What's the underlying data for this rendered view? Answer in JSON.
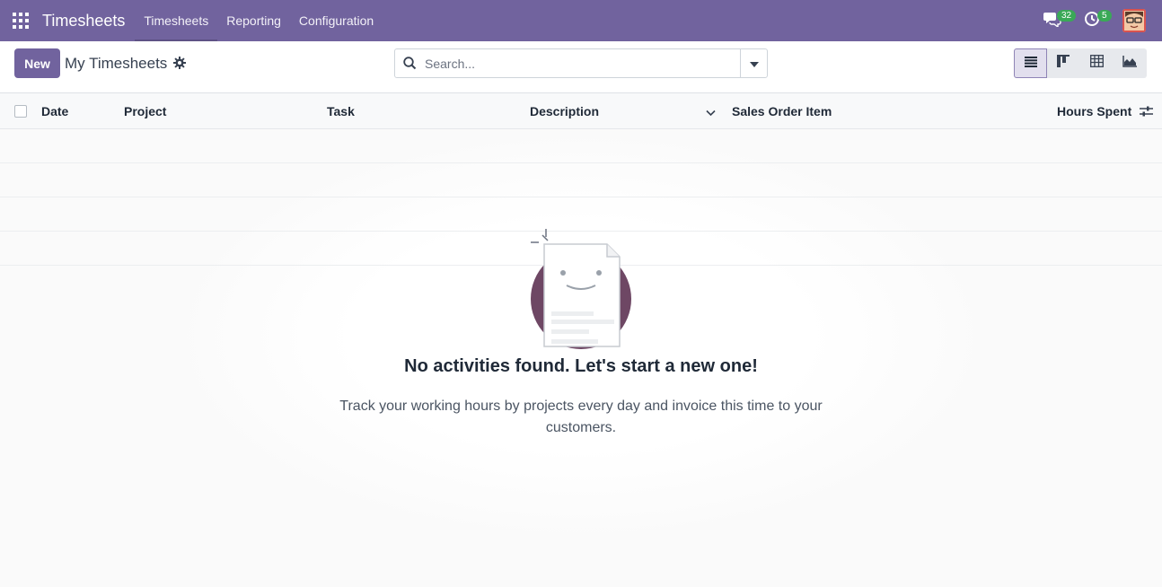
{
  "navbar": {
    "app_name": "Timesheets",
    "menu": [
      "Timesheets",
      "Reporting",
      "Configuration"
    ],
    "messages_count": "32",
    "activities_count": "5",
    "brand_color": "#71639e",
    "badge_color": "#3aa957"
  },
  "control_panel": {
    "new_label": "New",
    "breadcrumb_title": "My Timesheets",
    "search_placeholder": "Search...",
    "views": [
      "list-icon",
      "kanban-icon",
      "pivot-icon",
      "graph-icon"
    ],
    "active_view": "list"
  },
  "list": {
    "columns": [
      "Date",
      "Project",
      "Task",
      "Description",
      "Sales Order Item",
      "Hours Spent"
    ]
  },
  "empty_state": {
    "title": "No activities found. Let's start a new one!",
    "subtitle": "Track your working hours by projects every day and invoice this time to your customers."
  }
}
